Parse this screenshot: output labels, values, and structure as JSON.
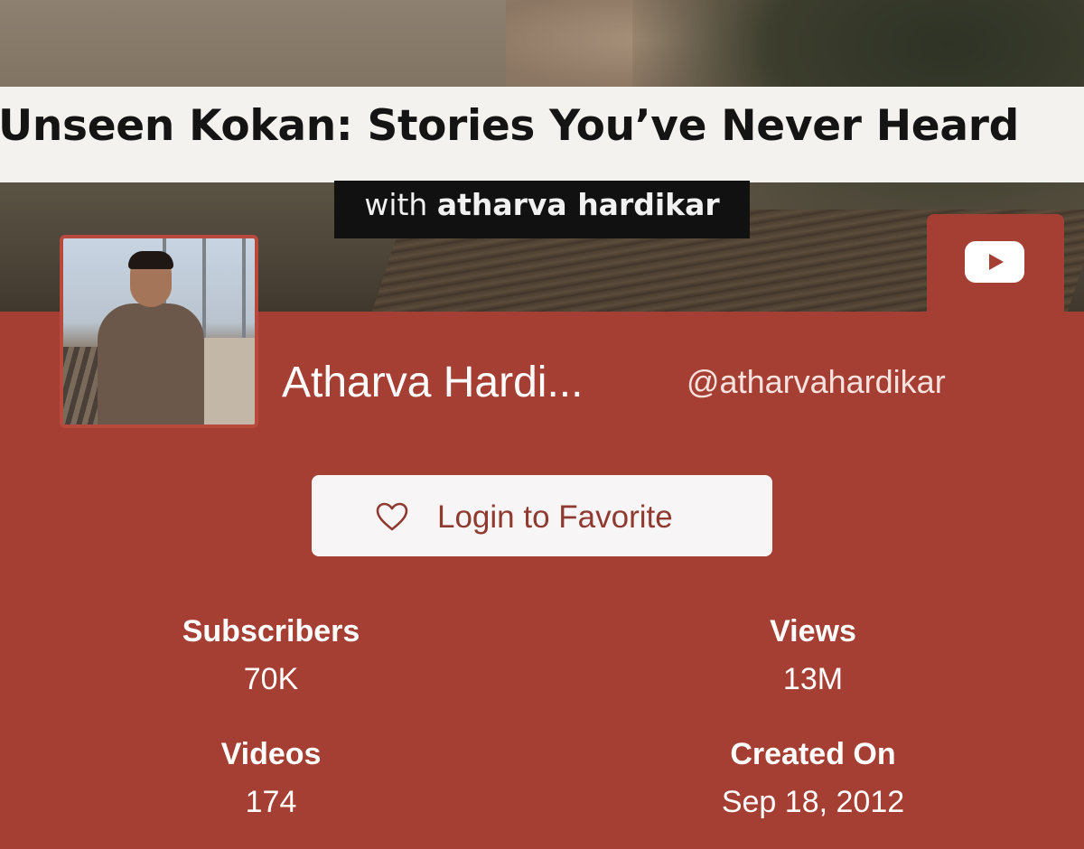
{
  "banner": {
    "title": "Unseen Kokan: Stories You’ve Never Heard",
    "subtitle_prefix": "with",
    "subtitle_name": "atharva hardikar"
  },
  "header": {
    "platform_icon": "youtube-icon",
    "channel_name": "Atharva Hardi...",
    "handle": "@atharvahardikar"
  },
  "actions": {
    "favorite_label": "Login to Favorite",
    "favorite_icon": "heart-outline-icon"
  },
  "stats": [
    {
      "label": "Subscribers",
      "value": "70K"
    },
    {
      "label": "Views",
      "value": "13M"
    },
    {
      "label": "Videos",
      "value": "174"
    },
    {
      "label": "Created On",
      "value": "Sep 18, 2012"
    }
  ],
  "colors": {
    "background": "#a63f33",
    "button_bg": "#f7f5f5",
    "button_text": "#8f3a30"
  }
}
